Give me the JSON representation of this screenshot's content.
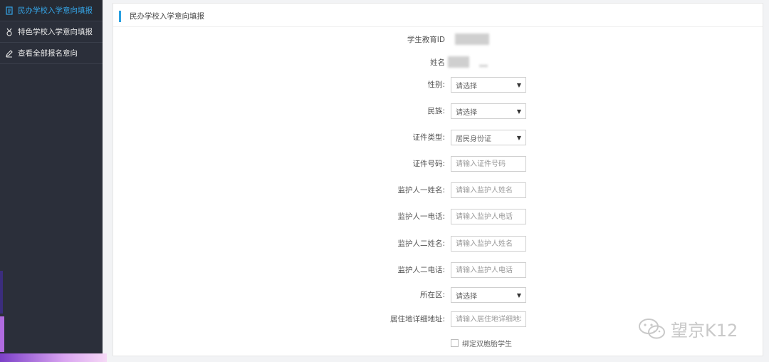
{
  "sidebar": {
    "items": [
      {
        "label": "民办学校入学意向填报",
        "icon": "form-icon",
        "active": true
      },
      {
        "label": "特色学校入学意向填报",
        "icon": "medal-icon",
        "active": false
      },
      {
        "label": "查看全部报名意向",
        "icon": "pencil-icon",
        "active": false
      }
    ]
  },
  "panel": {
    "title": "民办学校入学意向填报"
  },
  "form": {
    "student_id_label": "学生教育ID",
    "name_label": "姓名",
    "gender": {
      "label": "性别:",
      "value": "请选择"
    },
    "ethnicity": {
      "label": "民族:",
      "value": "请选择"
    },
    "id_type": {
      "label": "证件类型:",
      "value": "居民身份证"
    },
    "id_number": {
      "label": "证件号码:",
      "placeholder": "请输入证件号码"
    },
    "guardian1_name": {
      "label": "监护人一姓名:",
      "placeholder": "请输入监护人姓名"
    },
    "guardian1_phone": {
      "label": "监护人一电话:",
      "placeholder": "请输入监护人电话"
    },
    "guardian2_name": {
      "label": "监护人二姓名:",
      "placeholder": "请输入监护人姓名"
    },
    "guardian2_phone": {
      "label": "监护人二电话:",
      "placeholder": "请输入监护人电话"
    },
    "district": {
      "label": "所在区:",
      "value": "请选择"
    },
    "address": {
      "label": "居住地详细地址:",
      "placeholder": "请输入居住地详细地址"
    },
    "twin_checkbox": {
      "label": "绑定双胞胎学生",
      "checked": false
    }
  },
  "watermark": {
    "text": "望京K12",
    "icon": "wechat-icon"
  }
}
